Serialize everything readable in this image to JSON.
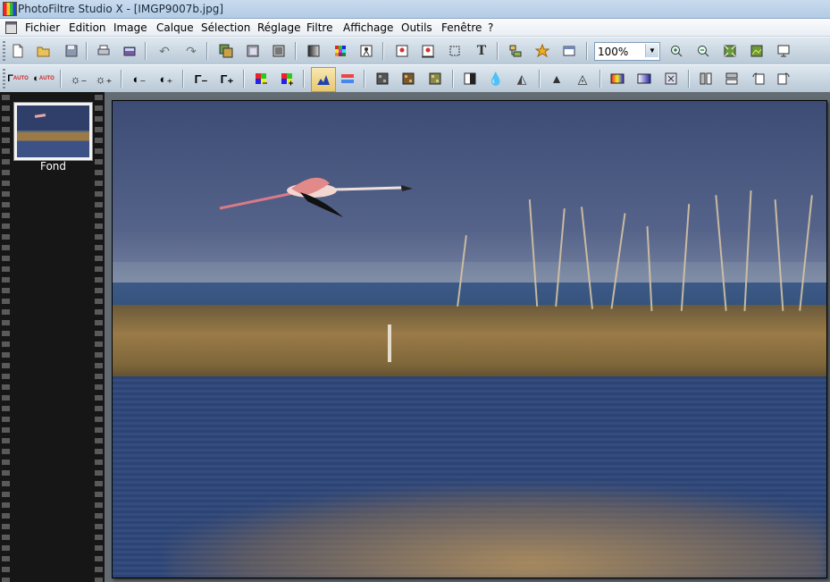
{
  "window": {
    "title": "PhotoFiltre Studio X - [IMGP9007b.jpg]"
  },
  "menu": {
    "items": [
      "Fichier",
      "Edition",
      "Image",
      "Calque",
      "Sélection",
      "Réglage",
      "Filtre",
      "Affichage",
      "Outils",
      "Fenêtre",
      "?"
    ]
  },
  "toolbar1": {
    "zoom_value": "100%",
    "icons": [
      "new-file-icon",
      "open-folder-icon",
      "save-icon",
      "print-icon",
      "scan-icon",
      "undo-icon",
      "redo-icon",
      "copy-layer-icon",
      "paste-icon",
      "layer-icon",
      "gradient-icon",
      "palette-icon",
      "effect-icon",
      "image-size-icon",
      "canvas-size-icon",
      "crop-icon",
      "text-icon",
      "layer-manager-icon",
      "star-icon",
      "window-icon",
      "zoom-in-icon",
      "zoom-out-icon",
      "fit-screen-icon",
      "full-image-icon",
      "slideshow-icon"
    ]
  },
  "toolbar2": {
    "icons": [
      "auto-levels-icon",
      "auto-contrast-icon",
      "brightness-minus-icon",
      "brightness-plus-icon",
      "contrast-minus-icon",
      "contrast-plus-icon",
      "gamma-minus-icon",
      "gamma-plus-icon",
      "saturation-minus-icon",
      "saturation-plus-icon",
      "histogram-icon",
      "color-balance-icon",
      "grayscale-icon",
      "sepia-icon",
      "pixelate-icon",
      "negative-icon",
      "drop-icon",
      "drop-outline-icon",
      "sharpen-icon",
      "blur-icon",
      "gradient-map-icon",
      "gradient-fill-icon",
      "transform-icon",
      "flip-horizontal-icon",
      "flip-vertical-icon",
      "rotate-left-icon",
      "rotate-right-icon"
    ]
  },
  "layers": {
    "items": [
      {
        "label": "Fond"
      }
    ]
  },
  "colors": {
    "titlebar": "#b3cbe6",
    "workspace": "#636b73",
    "layer_panel": "#161616"
  }
}
